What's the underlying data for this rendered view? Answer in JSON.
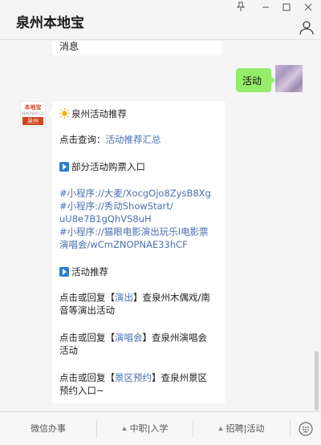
{
  "window": {
    "title": "泉州本地宝"
  },
  "chat": {
    "previous_msg": "消息",
    "my_msg": "活动",
    "account_logo": {
      "top": "本地宝",
      "mid": "BENDIBAO.COM",
      "bottom": "泉州"
    },
    "message": {
      "heading": "泉州活动推荐",
      "query_prefix": "点击查询：",
      "query_link": "活动推荐汇总",
      "section1": "部分活动购票入口",
      "mini1": "#小程序://大麦/XocgOjo8ZysB8Xg",
      "mini2a": "#小程序://秀动ShowStart/",
      "mini2b": "uU8e7B1gQhVS8uH",
      "mini3a": "#小程序://猫眼电影演出玩乐I电影票",
      "mini3b": "演唱会/wCmZNOPNAE33hCF",
      "section2": "活动推荐",
      "reply1_prefix": "点击或回复【",
      "reply1_kw": "演出",
      "reply1_suffix": "】查泉州木偶戏/南",
      "reply1_line2": "音等演出活动",
      "reply2_prefix": "点击或回复【",
      "reply2_kw": "演唱会",
      "reply2_suffix": "】查泉州演唱会",
      "reply2_line2": "活动",
      "reply3_prefix": "点击或回复【",
      "reply3_kw": "景区预约",
      "reply3_suffix": "】查泉州景区",
      "reply3_line2": "预约入口~"
    }
  },
  "menu": {
    "item1": "微信办事",
    "item2": "中职|入学",
    "item3": "招聘|活动"
  },
  "colors": {
    "bubble_green": "#95ec69",
    "link_blue": "#4b6fb0",
    "brand_red": "#d2451f"
  }
}
